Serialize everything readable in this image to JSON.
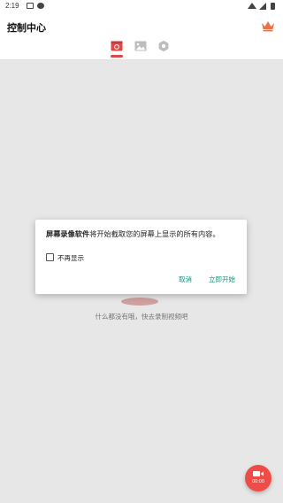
{
  "status_bar": {
    "time": "2:19"
  },
  "app_bar": {
    "title": "控制中心"
  },
  "tabs": [
    {
      "name": "recordings",
      "icon": "video-folder-icon",
      "active": true
    },
    {
      "name": "images",
      "icon": "image-icon",
      "active": false
    },
    {
      "name": "settings",
      "icon": "gear-icon",
      "active": false
    }
  ],
  "empty_state": {
    "message": "什么都没有哦，快去录制视频吧"
  },
  "dialog": {
    "app_name": "屏幕录像软件",
    "message": "将开始截取您的屏幕上显示的所有内容。",
    "checkbox_label": "不再显示",
    "checkbox_checked": false,
    "cancel_label": "取消",
    "start_label": "立即开始"
  },
  "fab": {
    "timer": "00:00"
  },
  "colors": {
    "accent": "#ee4d47",
    "dialog_button": "#1e8e7e",
    "crown": "#e8734a"
  }
}
